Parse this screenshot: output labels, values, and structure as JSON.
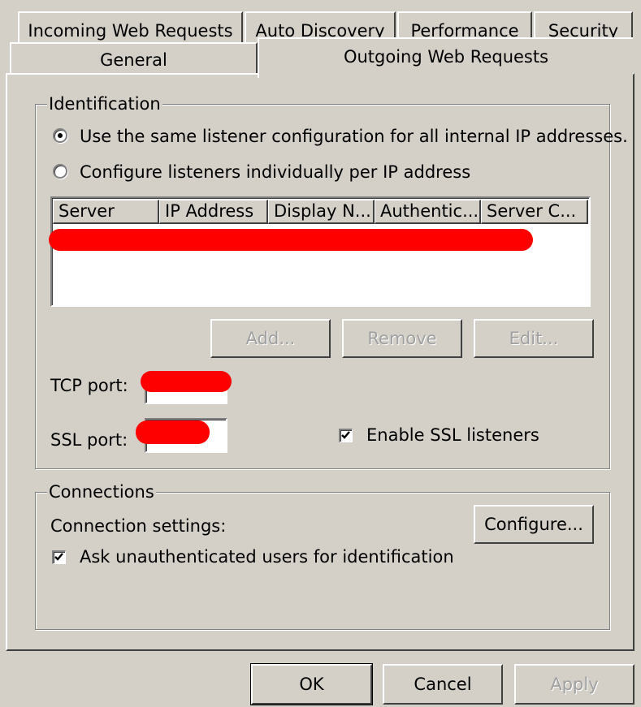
{
  "tabs": {
    "row_back": [
      "Incoming Web Requests",
      "Auto Discovery",
      "Performance",
      "Security"
    ],
    "row_front": [
      "General",
      "Outgoing Web Requests"
    ],
    "active": "Outgoing Web Requests"
  },
  "identification": {
    "title": "Identification",
    "radio_same": "Use the same listener configuration for all internal IP addresses.",
    "radio_individual": "Configure listeners individually per IP address",
    "selected": "radio_same",
    "columns": [
      "Server",
      "IP Address",
      "Display N...",
      "Authentic...",
      "Server C..."
    ],
    "add_label": "Add...",
    "remove_label": "Remove",
    "edit_label": "Edit...",
    "tcp_label": "TCP port:",
    "ssl_label": "SSL port:",
    "enable_ssl_label": "Enable SSL listeners",
    "enable_ssl_checked": true
  },
  "connections": {
    "title": "Connections",
    "settings_label": "Connection settings:",
    "configure_label": "Configure...",
    "ask_label": "Ask unauthenticated users for identification",
    "ask_checked": true
  },
  "footer": {
    "ok_label": "OK",
    "cancel_label": "Cancel",
    "apply_label": "Apply"
  },
  "colors": {
    "face": "#d4d0c8",
    "redaction": "#ff0000"
  }
}
